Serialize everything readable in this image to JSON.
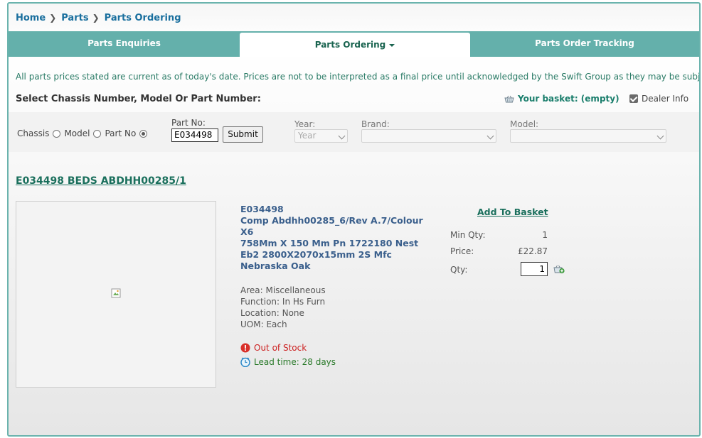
{
  "breadcrumb": [
    {
      "label": "Home"
    },
    {
      "label": "Parts"
    },
    {
      "label": "Parts Ordering"
    }
  ],
  "tabs": [
    {
      "label": "Parts Enquiries",
      "active": false
    },
    {
      "label": "Parts Ordering",
      "active": true
    },
    {
      "label": "Parts Order Tracking",
      "active": false
    }
  ],
  "notice": "All parts prices stated are current as of today's date. Prices are not to be interpreted as a final price until acknowledged by the Swift Group as they may be subject to change.",
  "select_heading": "Select Chassis Number, Model Or Part Number:",
  "basket_label": "Your basket: (empty)",
  "dealer_info": {
    "label": "Dealer Info",
    "checked": true
  },
  "search": {
    "radio_options": [
      {
        "label": "Chassis",
        "checked": false
      },
      {
        "label": "Model",
        "checked": false
      },
      {
        "label": "Part No",
        "checked": true
      }
    ],
    "part_no_label": "Part No:",
    "part_no_value": "E034498",
    "submit_label": "Submit",
    "year_label": "Year:",
    "year_value": "Year",
    "brand_label": "Brand:",
    "brand_value": "",
    "model_label": "Model:",
    "model_value": ""
  },
  "product": {
    "title": "E034498 BEDS ABDHH00285/1",
    "description": "E034498\nComp Abdhh00285_6/Rev A.7/Colour X6\n758Mm X 150 Mm Pn 1722180 Nest Eb2 2800X2070x15mm 2S Mfc Nebraska Oak",
    "area": "Area: Miscellaneous",
    "function": "Function: In Hs Furn",
    "location": "Location: None",
    "uom": "UOM: Each",
    "stock_status": "Out of Stock",
    "lead_time": "Lead time: 28 days",
    "add_to_basket": "Add To Basket",
    "min_qty_label": "Min Qty:",
    "min_qty_value": "1",
    "price_label": "Price:",
    "price_value": "£22.87",
    "qty_label": "Qty:",
    "qty_value": "1"
  },
  "colors": {
    "accent": "#64b0ab",
    "link": "#1a6f5c",
    "out_of_stock": "#cc1f1f",
    "lead_time": "#2a7a2a"
  }
}
